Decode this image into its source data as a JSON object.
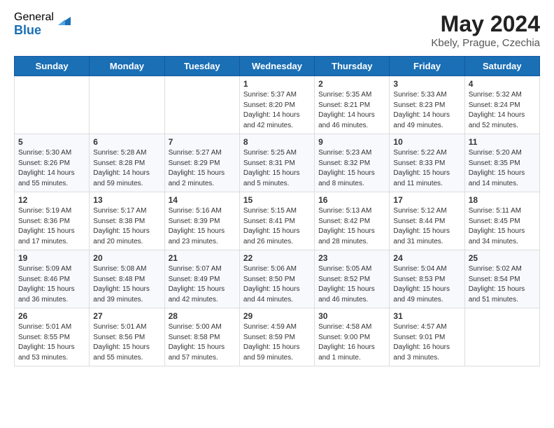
{
  "logo": {
    "general": "General",
    "blue": "Blue"
  },
  "title": "May 2024",
  "subtitle": "Kbely, Prague, Czechia",
  "days_of_week": [
    "Sunday",
    "Monday",
    "Tuesday",
    "Wednesday",
    "Thursday",
    "Friday",
    "Saturday"
  ],
  "weeks": [
    [
      {
        "day": "",
        "info": ""
      },
      {
        "day": "",
        "info": ""
      },
      {
        "day": "",
        "info": ""
      },
      {
        "day": "1",
        "info": "Sunrise: 5:37 AM\nSunset: 8:20 PM\nDaylight: 14 hours\nand 42 minutes."
      },
      {
        "day": "2",
        "info": "Sunrise: 5:35 AM\nSunset: 8:21 PM\nDaylight: 14 hours\nand 46 minutes."
      },
      {
        "day": "3",
        "info": "Sunrise: 5:33 AM\nSunset: 8:23 PM\nDaylight: 14 hours\nand 49 minutes."
      },
      {
        "day": "4",
        "info": "Sunrise: 5:32 AM\nSunset: 8:24 PM\nDaylight: 14 hours\nand 52 minutes."
      }
    ],
    [
      {
        "day": "5",
        "info": "Sunrise: 5:30 AM\nSunset: 8:26 PM\nDaylight: 14 hours\nand 55 minutes."
      },
      {
        "day": "6",
        "info": "Sunrise: 5:28 AM\nSunset: 8:28 PM\nDaylight: 14 hours\nand 59 minutes."
      },
      {
        "day": "7",
        "info": "Sunrise: 5:27 AM\nSunset: 8:29 PM\nDaylight: 15 hours\nand 2 minutes."
      },
      {
        "day": "8",
        "info": "Sunrise: 5:25 AM\nSunset: 8:31 PM\nDaylight: 15 hours\nand 5 minutes."
      },
      {
        "day": "9",
        "info": "Sunrise: 5:23 AM\nSunset: 8:32 PM\nDaylight: 15 hours\nand 8 minutes."
      },
      {
        "day": "10",
        "info": "Sunrise: 5:22 AM\nSunset: 8:33 PM\nDaylight: 15 hours\nand 11 minutes."
      },
      {
        "day": "11",
        "info": "Sunrise: 5:20 AM\nSunset: 8:35 PM\nDaylight: 15 hours\nand 14 minutes."
      }
    ],
    [
      {
        "day": "12",
        "info": "Sunrise: 5:19 AM\nSunset: 8:36 PM\nDaylight: 15 hours\nand 17 minutes."
      },
      {
        "day": "13",
        "info": "Sunrise: 5:17 AM\nSunset: 8:38 PM\nDaylight: 15 hours\nand 20 minutes."
      },
      {
        "day": "14",
        "info": "Sunrise: 5:16 AM\nSunset: 8:39 PM\nDaylight: 15 hours\nand 23 minutes."
      },
      {
        "day": "15",
        "info": "Sunrise: 5:15 AM\nSunset: 8:41 PM\nDaylight: 15 hours\nand 26 minutes."
      },
      {
        "day": "16",
        "info": "Sunrise: 5:13 AM\nSunset: 8:42 PM\nDaylight: 15 hours\nand 28 minutes."
      },
      {
        "day": "17",
        "info": "Sunrise: 5:12 AM\nSunset: 8:44 PM\nDaylight: 15 hours\nand 31 minutes."
      },
      {
        "day": "18",
        "info": "Sunrise: 5:11 AM\nSunset: 8:45 PM\nDaylight: 15 hours\nand 34 minutes."
      }
    ],
    [
      {
        "day": "19",
        "info": "Sunrise: 5:09 AM\nSunset: 8:46 PM\nDaylight: 15 hours\nand 36 minutes."
      },
      {
        "day": "20",
        "info": "Sunrise: 5:08 AM\nSunset: 8:48 PM\nDaylight: 15 hours\nand 39 minutes."
      },
      {
        "day": "21",
        "info": "Sunrise: 5:07 AM\nSunset: 8:49 PM\nDaylight: 15 hours\nand 42 minutes."
      },
      {
        "day": "22",
        "info": "Sunrise: 5:06 AM\nSunset: 8:50 PM\nDaylight: 15 hours\nand 44 minutes."
      },
      {
        "day": "23",
        "info": "Sunrise: 5:05 AM\nSunset: 8:52 PM\nDaylight: 15 hours\nand 46 minutes."
      },
      {
        "day": "24",
        "info": "Sunrise: 5:04 AM\nSunset: 8:53 PM\nDaylight: 15 hours\nand 49 minutes."
      },
      {
        "day": "25",
        "info": "Sunrise: 5:02 AM\nSunset: 8:54 PM\nDaylight: 15 hours\nand 51 minutes."
      }
    ],
    [
      {
        "day": "26",
        "info": "Sunrise: 5:01 AM\nSunset: 8:55 PM\nDaylight: 15 hours\nand 53 minutes."
      },
      {
        "day": "27",
        "info": "Sunrise: 5:01 AM\nSunset: 8:56 PM\nDaylight: 15 hours\nand 55 minutes."
      },
      {
        "day": "28",
        "info": "Sunrise: 5:00 AM\nSunset: 8:58 PM\nDaylight: 15 hours\nand 57 minutes."
      },
      {
        "day": "29",
        "info": "Sunrise: 4:59 AM\nSunset: 8:59 PM\nDaylight: 15 hours\nand 59 minutes."
      },
      {
        "day": "30",
        "info": "Sunrise: 4:58 AM\nSunset: 9:00 PM\nDaylight: 16 hours\nand 1 minute."
      },
      {
        "day": "31",
        "info": "Sunrise: 4:57 AM\nSunset: 9:01 PM\nDaylight: 16 hours\nand 3 minutes."
      },
      {
        "day": "",
        "info": ""
      }
    ]
  ]
}
